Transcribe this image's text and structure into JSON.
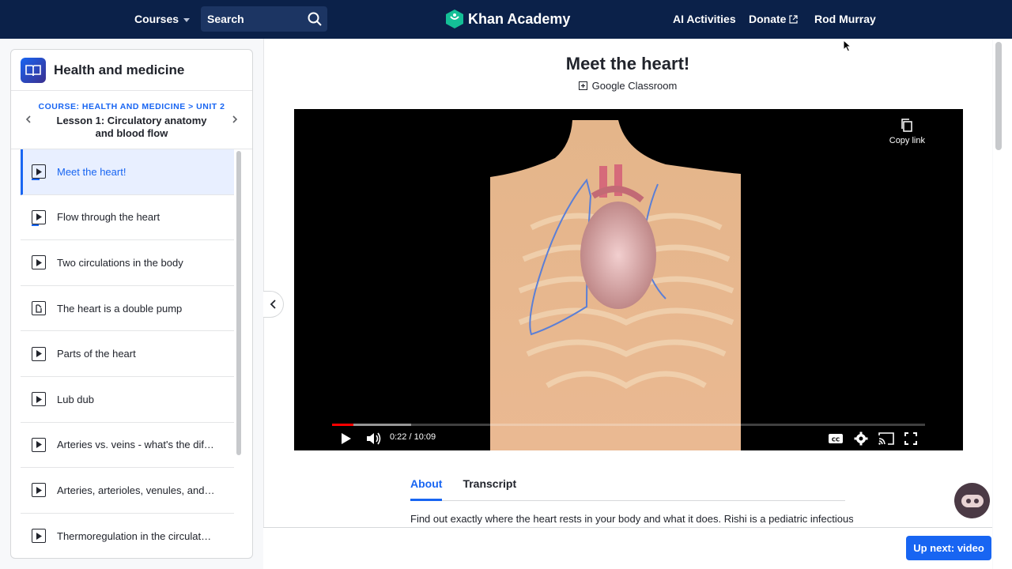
{
  "nav": {
    "courses_label": "Courses",
    "search_placeholder": "Search",
    "logo_text": "Khan Academy",
    "ai_activities": "AI Activities",
    "donate": "Donate",
    "user_name": "Rod Murray"
  },
  "sidebar": {
    "course_title": "Health and medicine",
    "breadcrumb": "COURSE: HEALTH AND MEDICINE > UNIT 2",
    "lesson_title": "Lesson 1: Circulatory anatomy and blood flow",
    "items": [
      {
        "label": "Meet the heart!",
        "icon": "video-icon",
        "active": true
      },
      {
        "label": "Flow through the heart",
        "icon": "video-icon"
      },
      {
        "label": "Two circulations in the body",
        "icon": "video-icon"
      },
      {
        "label": "The heart is a double pump",
        "icon": "article-icon"
      },
      {
        "label": "Parts of the heart",
        "icon": "video-icon"
      },
      {
        "label": "Lub dub",
        "icon": "video-icon"
      },
      {
        "label": "Arteries vs. veins - what's the diff...",
        "icon": "video-icon"
      },
      {
        "label": "Arteries, arterioles, venules, and ...",
        "icon": "video-icon"
      },
      {
        "label": "Thermoregulation in the circulato...",
        "icon": "video-icon"
      }
    ]
  },
  "main": {
    "title": "Meet the heart!",
    "classroom_label": "Google Classroom",
    "video": {
      "copy_link": "Copy link",
      "time": "0:22 / 10:09",
      "played_fraction": 0.036,
      "buffered_fraction": 0.133
    },
    "tabs": [
      "About",
      "Transcript"
    ],
    "active_tab": "About",
    "description": "Find out exactly where the heart rests in your body and what it does. Rishi is a pediatric infectious",
    "up_next": "Up next: video"
  },
  "colors": {
    "nav_bg": "#0b2149",
    "accent": "#1865f2",
    "logo_green": "#14bf96"
  }
}
